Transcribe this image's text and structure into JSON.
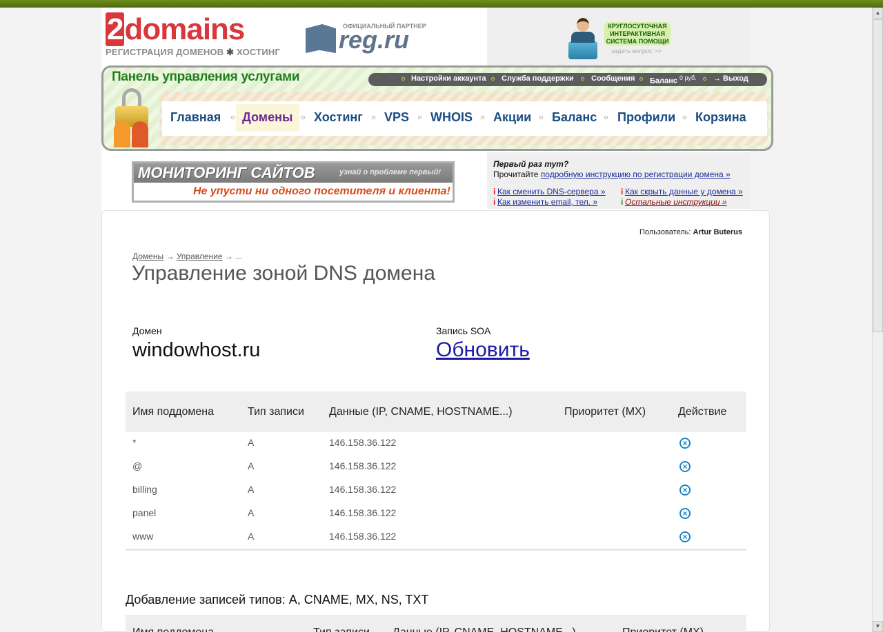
{
  "logo": {
    "two": "2",
    "name": "domains",
    "sub_left": "РЕГИСТРАЦИЯ ДОМЕНОВ",
    "sub_star": "✱",
    "sub_right": "ХОСТИНГ"
  },
  "partner": {
    "caption": "ОФИЦИАЛЬНЫЙ ПАРТНЕР",
    "name": "reg.ru"
  },
  "help": {
    "line1": "КРУГЛОСУТОЧНАЯ",
    "line2": "ИНТЕРАКТИВНАЯ",
    "line3": "СИСТЕМА ПОМОЩИ",
    "ask": "задать вопрос >>"
  },
  "panel": {
    "title": "Панель управления услугами"
  },
  "account_bar": {
    "settings": "Настройки аккаунта",
    "support": "Служба поддержки",
    "messages": "Сообщения",
    "balance": "Баланс",
    "balance_value": "0 руб.",
    "logout": "→ Выход"
  },
  "nav": {
    "items": [
      {
        "label": "Главная"
      },
      {
        "label": "Домены"
      },
      {
        "label": "Хостинг"
      },
      {
        "label": "VPS"
      },
      {
        "label": "WHOIS"
      },
      {
        "label": "Акции"
      },
      {
        "label": "Баланс"
      },
      {
        "label": "Профили"
      },
      {
        "label": "Корзина"
      }
    ],
    "active_index": 1
  },
  "banner": {
    "title": "МОНИТОРИНГ САЙТОВ",
    "subtitle": "узнай о проблеме первый!",
    "slogan": "Не упусти ни одного посетителя и клиента!"
  },
  "info": {
    "title": "Первый раз тут?",
    "read_prefix": "Прочитайте",
    "read_link": "подробную инструкцию по регистрации домена »",
    "mark": "i",
    "links": [
      "Как сменить DNS-сервера »",
      "Как скрыть данные у домена »",
      "Как изменить email, тел. »",
      "Остальные инструкции »"
    ]
  },
  "user": {
    "label": "Пользователь:",
    "name": "Artur Buterus"
  },
  "breadcrumb": {
    "domains": "Домены",
    "arrow": "→",
    "manage": "Управление",
    "more": "..."
  },
  "page_title": "Управление зоной DNS домена",
  "domain": {
    "label": "Домен",
    "value": "windowhost.ru"
  },
  "soa": {
    "label": "Запись SOA",
    "action": "Обновить"
  },
  "records_table": {
    "headers": {
      "subdomain": "Имя поддомена",
      "type": "Тип записи",
      "data": "Данные (IP, CNAME, HOSTNAME...)",
      "priority": "Приоритет (MX)",
      "action": "Действие"
    },
    "rows": [
      {
        "subdomain": "*",
        "type": "A",
        "data": "146.158.36.122",
        "priority": ""
      },
      {
        "subdomain": "@",
        "type": "A",
        "data": "146.158.36.122",
        "priority": ""
      },
      {
        "subdomain": "billing",
        "type": "A",
        "data": "146.158.36.122",
        "priority": ""
      },
      {
        "subdomain": "panel",
        "type": "A",
        "data": "146.158.36.122",
        "priority": ""
      },
      {
        "subdomain": "www",
        "type": "A",
        "data": "146.158.36.122",
        "priority": ""
      }
    ],
    "delete_glyph": "×"
  },
  "add_section": {
    "title": "Добавление записей типов: A, CNAME, MX, NS, TXT",
    "headers": {
      "subdomain": "Имя поддомена",
      "type": "Тип записи",
      "data": "Данные (IP, CNAME, HOSTNAME...)",
      "priority": "Приоритет (MX)"
    }
  },
  "scrollbar": {
    "up": "▲",
    "down": "▼"
  }
}
